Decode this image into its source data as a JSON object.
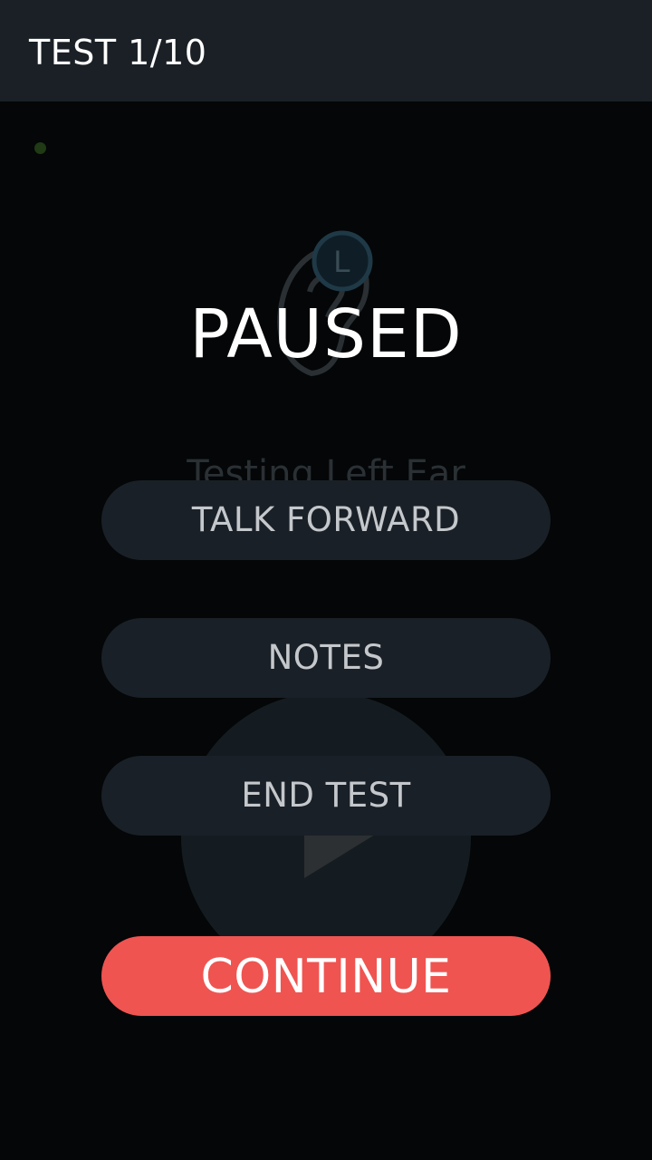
{
  "header": {
    "title": "TEST 1/10"
  },
  "background": {
    "ear_badge_letter": "L",
    "subtitle": "Testing Left Ear",
    "play_icon": "play-icon",
    "ear_icon": "ear-icon"
  },
  "overlay": {
    "title": "PAUSED",
    "buttons": {
      "talk_forward": "TALK FORWARD",
      "notes": "NOTES",
      "end_test": "END TEST",
      "continue": "CONTINUE"
    }
  },
  "colors": {
    "topbar": "#1a2026",
    "button": "#1a2027",
    "continue": "#ef5451",
    "status_dot": "#1f3a14"
  }
}
